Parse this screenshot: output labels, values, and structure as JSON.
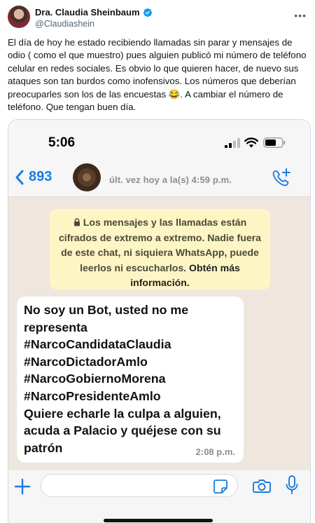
{
  "tweet": {
    "display_name": "Dra. Claudia Sheinbaum",
    "handle": "@Claudiashein",
    "more_icon": "more-horizontal-icon",
    "verified_icon": "verified-badge-icon",
    "verified_color": "#1d9bf0",
    "text": "El día de hoy he estado recibiendo llamadas sin parar y mensajes de odio ( como el que muestro) pues alguien publicó mi número de teléfono celular en redes sociales. Es obvio lo que quieren hacer, de nuevo sus ataques son tan burdos como inofensivos. Los números que deberían preocuparles son los de las encuestas 😂. A cambiar el número de teléfono. Que tengan buen día."
  },
  "phone": {
    "status_time": "5:06",
    "back_count": "893",
    "last_seen": "últ. vez hoy a la(s) 4:59 p.m.",
    "accent_color": "#1a7be0",
    "encryption_notice": "Los mensajes y las llamadas están cifrados de extremo a extremo. Nadie fuera de este chat, ni siquiera WhatsApp, puede leerlos ni escucharlos.",
    "encryption_link": "Obtén más información.",
    "message": {
      "text": "No soy un Bot, usted no me representa\n#NarcoCandidataClaudia\n#NarcoDictadorAmlo\n#NarcoGobiernoMorena\n#NarcoPresidenteAmlo\nQuiere echarle la culpa a alguien, acuda a Palacio y quéjese con su patrón",
      "time": "2:08 p.m."
    },
    "input_placeholder": ""
  }
}
